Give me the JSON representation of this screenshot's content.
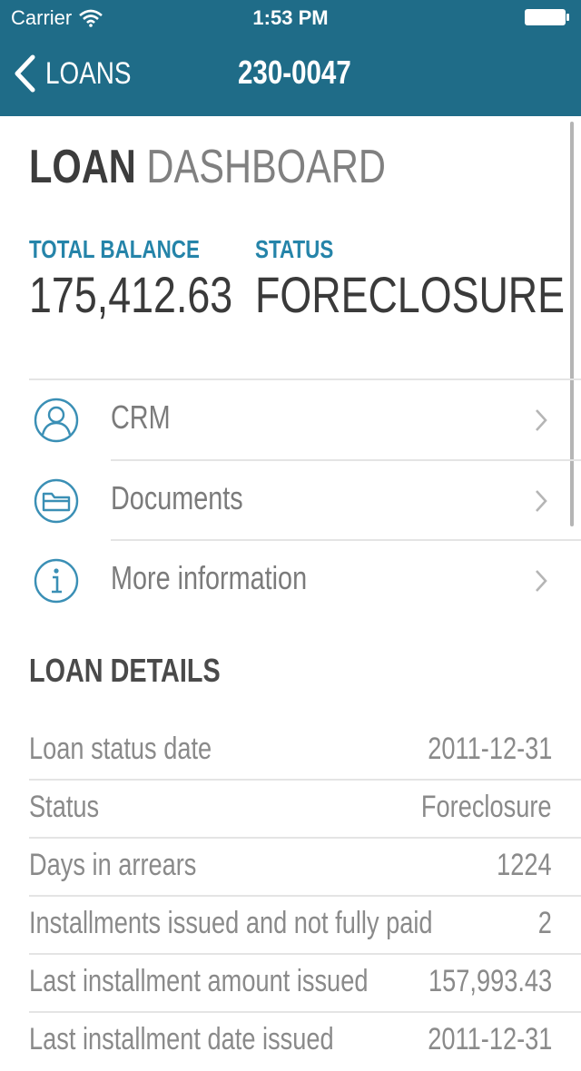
{
  "status_bar": {
    "carrier": "Carrier",
    "time": "1:53 PM"
  },
  "nav": {
    "back_label": "LOANS",
    "title": "230-0047"
  },
  "page_title": {
    "strong": "LOAN",
    "light": "DASHBOARD"
  },
  "summary": {
    "total_balance_label": "TOTAL BALANCE",
    "total_balance_value": "175,412.63",
    "status_label": "STATUS",
    "status_value": "FORECLOSURE"
  },
  "menu": [
    {
      "label": "CRM",
      "icon": "person-icon"
    },
    {
      "label": "Documents",
      "icon": "folder-icon"
    },
    {
      "label": "More information",
      "icon": "info-icon"
    }
  ],
  "loan_details": {
    "heading": "LOAN DETAILS",
    "rows": [
      {
        "label": "Loan status date",
        "value": "2011-12-31"
      },
      {
        "label": "Status",
        "value": "Foreclosure"
      },
      {
        "label": "Days in arrears",
        "value": "1224"
      },
      {
        "label": "Installments issued and not fully paid",
        "value": "2"
      },
      {
        "label": "Last installment amount issued",
        "value": "157,993.43"
      },
      {
        "label": "Last installment date issued",
        "value": "2011-12-31"
      }
    ]
  },
  "colors": {
    "header_bg": "#1f6c88",
    "accent": "#2584a9",
    "icon": "#3a8fb5"
  }
}
